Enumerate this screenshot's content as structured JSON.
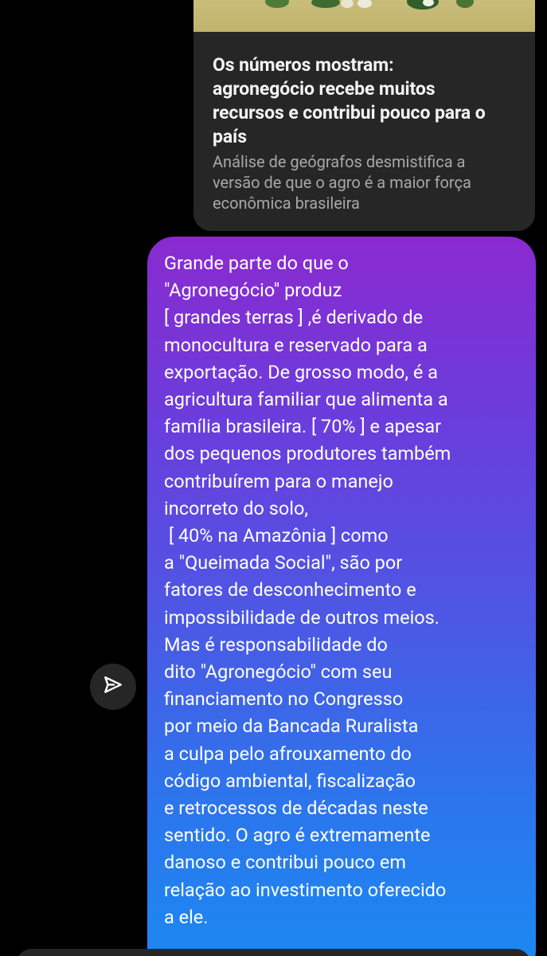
{
  "shared_post": {
    "title": "Os números mostram:\nagronegócio recebe muitos\nrecursos e contribui pouco para o\npaís",
    "description": "Análise de geógrafos desmistifica a\nversão de que o agro é a maior força\neconômica brasileira"
  },
  "message": {
    "text": "Grande parte do que o\n\"Agronegócio\" produz\n[ grandes terras ] ,é derivado de\nmonocultura e reservado para a\nexportação. De grosso modo, é a\nagricultura familiar que alimenta a\nfamília brasileira. [ 70% ] e apesar\ndos pequenos produtores também\ncontribuírem para o manejo\nincorreto do solo,\n [ 40% na Amazônia ] como\na \"Queimada Social\", são por\nfatores de desconhecimento e\nimpossibilidade de outros meios.\nMas é responsabilidade do\ndito \"Agronegócio\" com seu\nfinanciamento no Congresso\npor meio da Bancada Ruralista\na culpa pelo afrouxamento do\ncódigo ambiental, fiscalização\ne retrocessos de décadas neste\nsentido. O agro é extremamente\ndanoso e contribui pouco em\nrelação ao investimento oferecido\na ele."
  },
  "icons": {
    "share": "paper-plane-icon"
  },
  "colors": {
    "background": "#000000",
    "card": "#262626",
    "bubble_top": "#8a2ad0",
    "bubble_bottom": "#1a8af2"
  }
}
